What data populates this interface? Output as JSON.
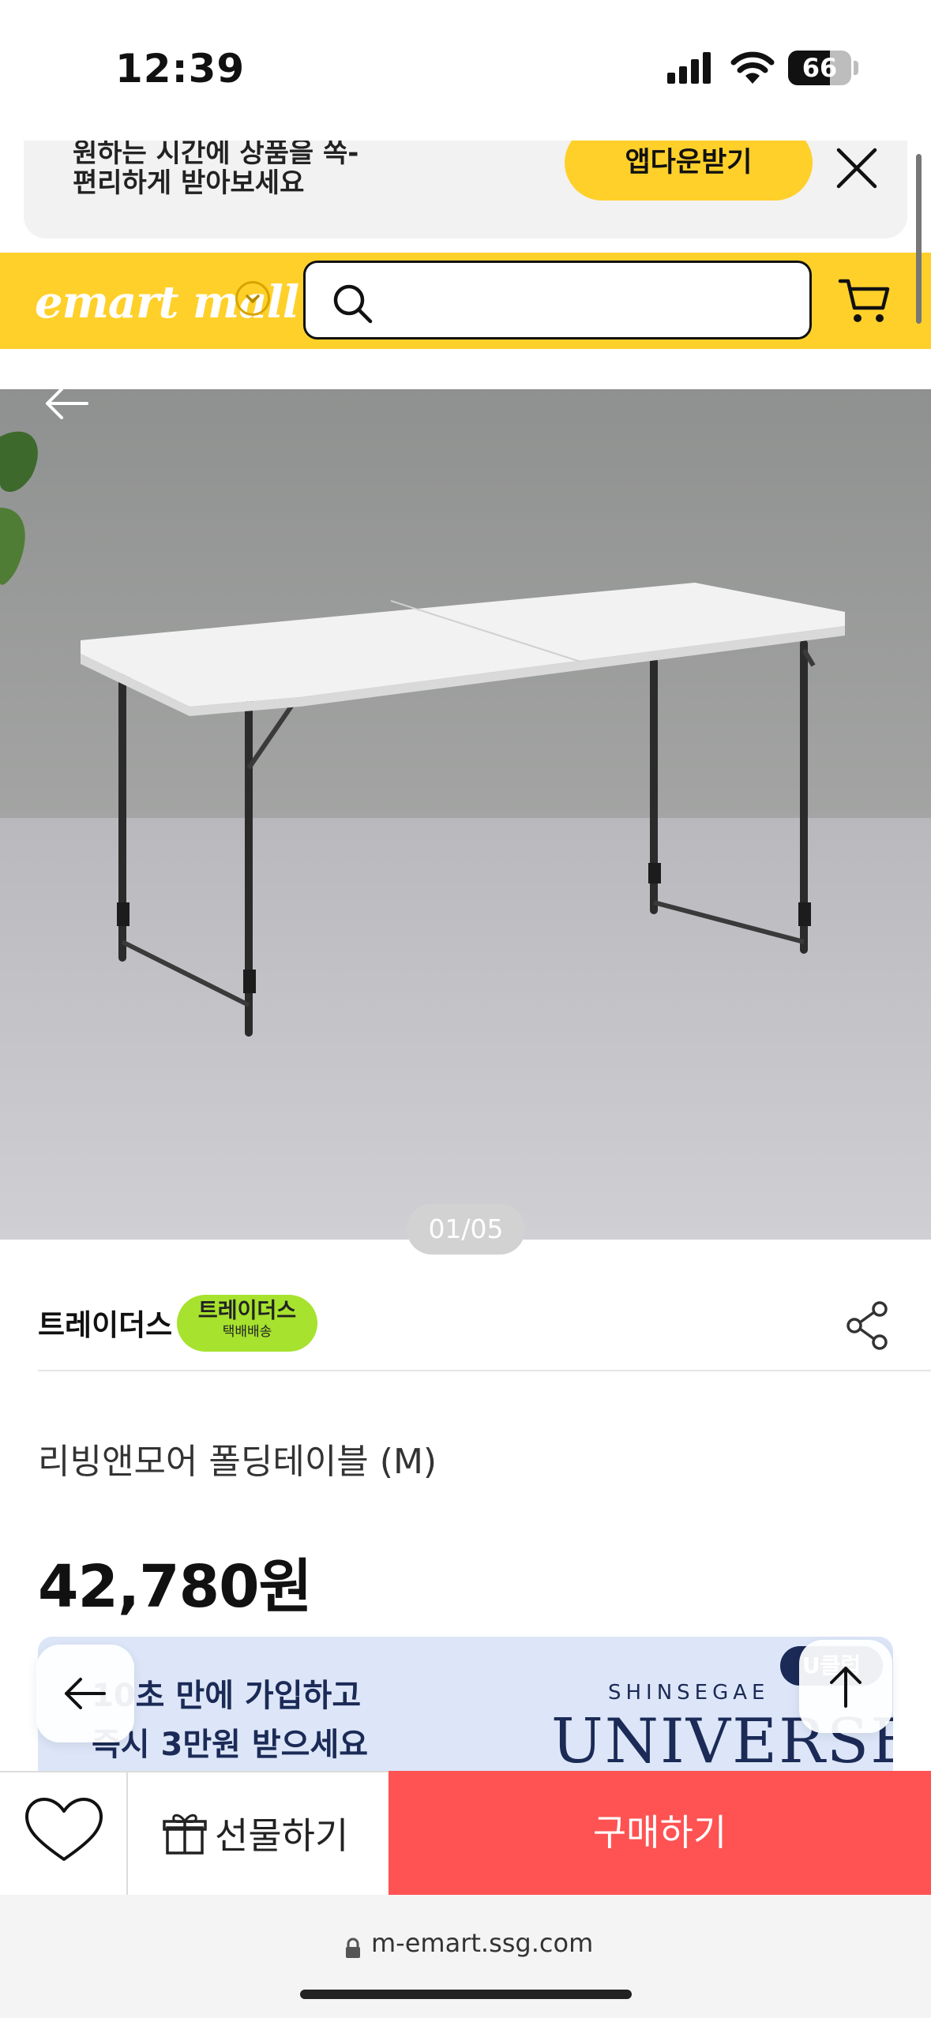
{
  "status_bar": {
    "time": "12:39",
    "battery": "66",
    "battery_level": 0.66
  },
  "app_banner": {
    "line1": "원하는 시간에 상품을 쏙-",
    "line2": "편리하게 받아보세요",
    "download_button": "앱다운받기",
    "close_icon": "close-icon"
  },
  "header": {
    "logo": "emart mall",
    "search_placeholder": "",
    "icons": [
      "chevron-down-icon",
      "search-icon",
      "cart-icon"
    ]
  },
  "product": {
    "image_counter": "01/05",
    "seller": "트레이더스",
    "delivery_badge_title": "트레이더스",
    "delivery_badge_sub": "택배배송",
    "name": "리빙앤모어 폴딩테이블 (M)",
    "price": "42,780원"
  },
  "promo": {
    "line1": "10초 만에 가입하고",
    "line2": "즉시 3만원 받으세요",
    "brand_top": "SHINSEGAE",
    "brand_main": "UNIVERSE",
    "club_badge": "U클럽"
  },
  "action_bar": {
    "gift_label": "선물하기",
    "buy_label": "구매하기"
  },
  "browser": {
    "url": "m-emart.ssg.com"
  },
  "colors": {
    "accent": "#ffd02a",
    "buy": "#ff5252",
    "badge": "#a6e22e"
  }
}
